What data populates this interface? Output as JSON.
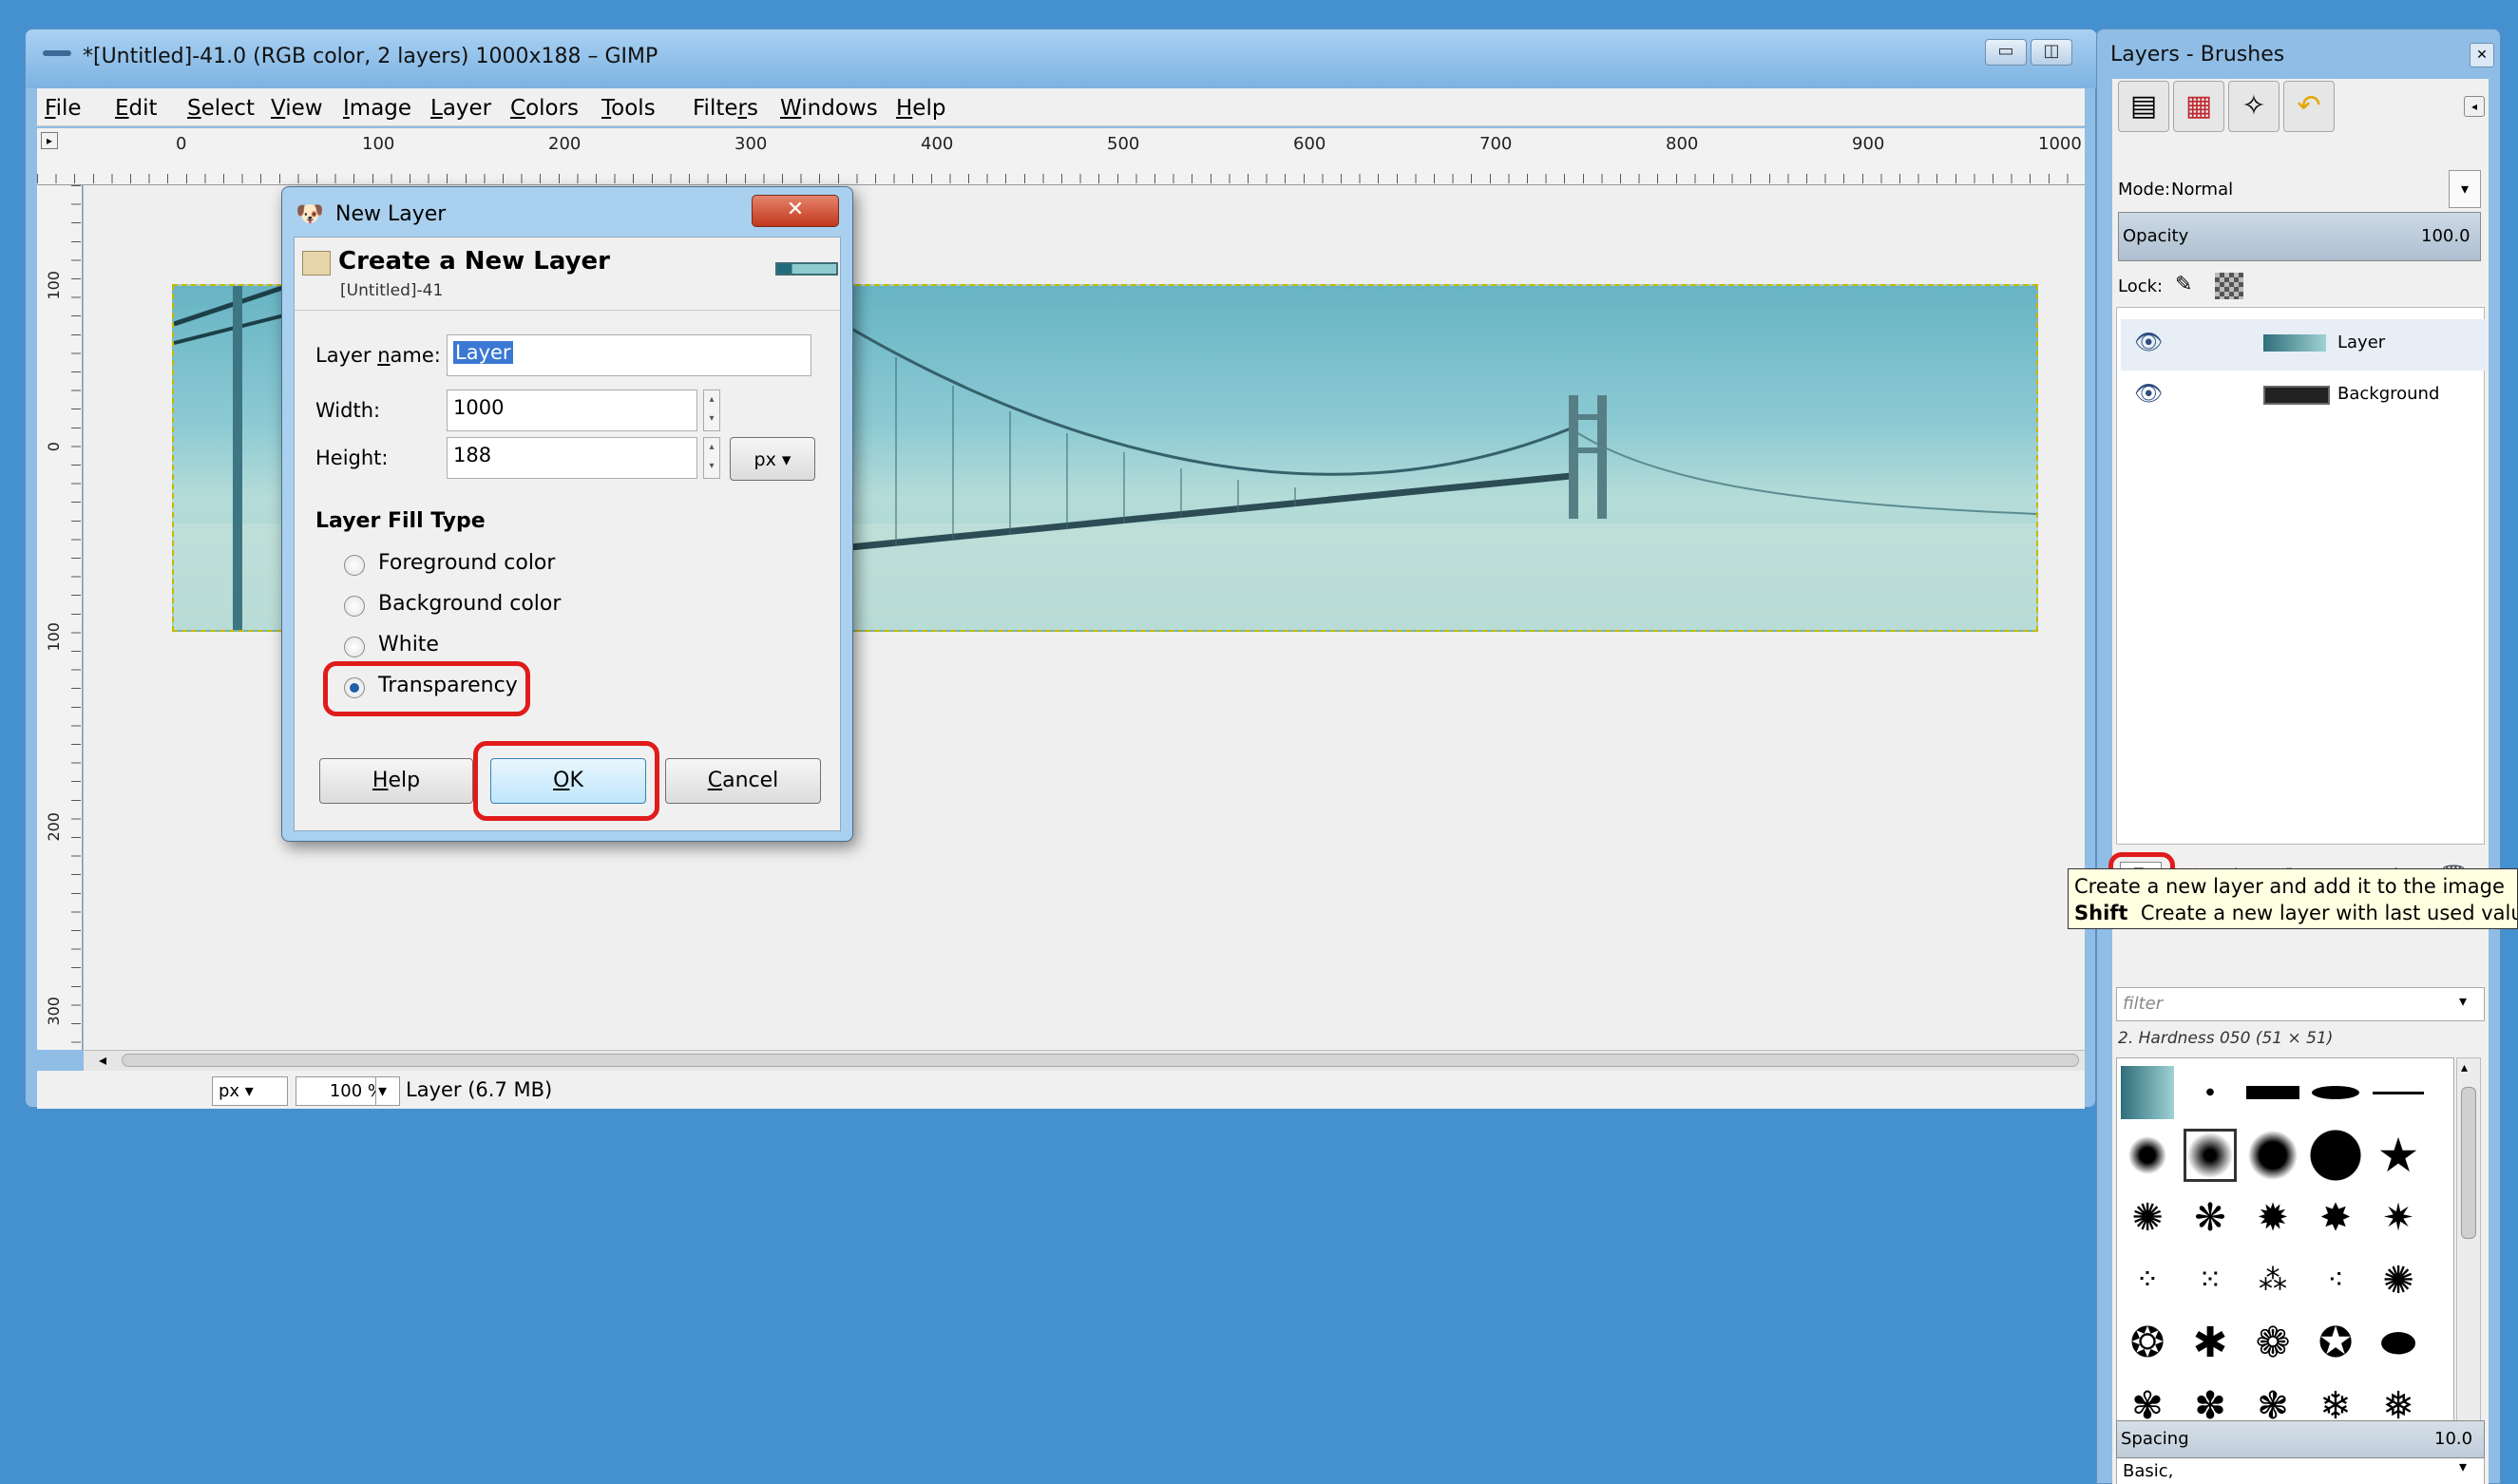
{
  "main_window": {
    "title": "*[Untitled]-41.0 (RGB color, 2 layers) 1000x188 – GIMP",
    "menu": [
      {
        "pre": "",
        "u": "F",
        "post": "ile"
      },
      {
        "pre": "",
        "u": "E",
        "post": "dit"
      },
      {
        "pre": "",
        "u": "S",
        "post": "elect"
      },
      {
        "pre": "",
        "u": "V",
        "post": "iew"
      },
      {
        "pre": "",
        "u": "I",
        "post": "mage"
      },
      {
        "pre": "",
        "u": "L",
        "post": "ayer"
      },
      {
        "pre": "",
        "u": "C",
        "post": "olors"
      },
      {
        "pre": "",
        "u": "T",
        "post": "ools"
      },
      {
        "pre": "Filte",
        "u": "r",
        "post": "s"
      },
      {
        "pre": "",
        "u": "W",
        "post": "indows"
      },
      {
        "pre": "",
        "u": "H",
        "post": "elp"
      }
    ],
    "hruler_labels": [
      "0",
      "100",
      "200",
      "300",
      "400",
      "500",
      "600",
      "700",
      "800",
      "900",
      "1000"
    ],
    "vruler_labels": [
      "100",
      "0",
      "100",
      "200",
      "300"
    ],
    "status": {
      "unit": "px",
      "zoom": "100 %",
      "info": "Layer (6.7 MB)"
    }
  },
  "dialog": {
    "title": "New Layer",
    "close_label": "✕",
    "heading": "Create a New Layer",
    "subheading": "[Untitled]-41",
    "layer_name_label": {
      "pre": "Layer ",
      "u": "n",
      "post": "ame:"
    },
    "layer_name_value": "Layer",
    "width_label": "Width:",
    "width_value": "1000",
    "height_label": "Height:",
    "height_value": "188",
    "unit": "px",
    "fill_type_heading": "Layer Fill Type",
    "fill_options": [
      "Foreground color",
      "Background color",
      "White",
      "Transparency"
    ],
    "selected_fill": "Transparency",
    "buttons": {
      "help": {
        "pre": "",
        "u": "H",
        "post": "elp"
      },
      "ok": {
        "pre": "",
        "u": "O",
        "post": "K"
      },
      "cancel": {
        "pre": "",
        "u": "C",
        "post": "ancel"
      }
    }
  },
  "dock": {
    "title": "Layers - Brushes",
    "mode_label": "Mode:",
    "mode_value": "Normal",
    "opacity_label": "Opacity",
    "opacity_value": "100.0",
    "lock_label": "Lock:",
    "layers": [
      {
        "name": "Layer"
      },
      {
        "name": "Background"
      }
    ],
    "tooltip": {
      "line1": "Create a new layer and add it to the image",
      "shift_key": "Shift",
      "line2": "Create a new layer with last used values"
    },
    "filter_placeholder": "filter",
    "brush_info": "2. Hardness 050 (51 × 51)",
    "brush_set": "Basic,",
    "spacing_label": "Spacing",
    "spacing_value": "10.0"
  },
  "colors": {
    "desktop": "#4590cf",
    "highlight": "#e01b1b",
    "selection": "#3a78d3"
  }
}
